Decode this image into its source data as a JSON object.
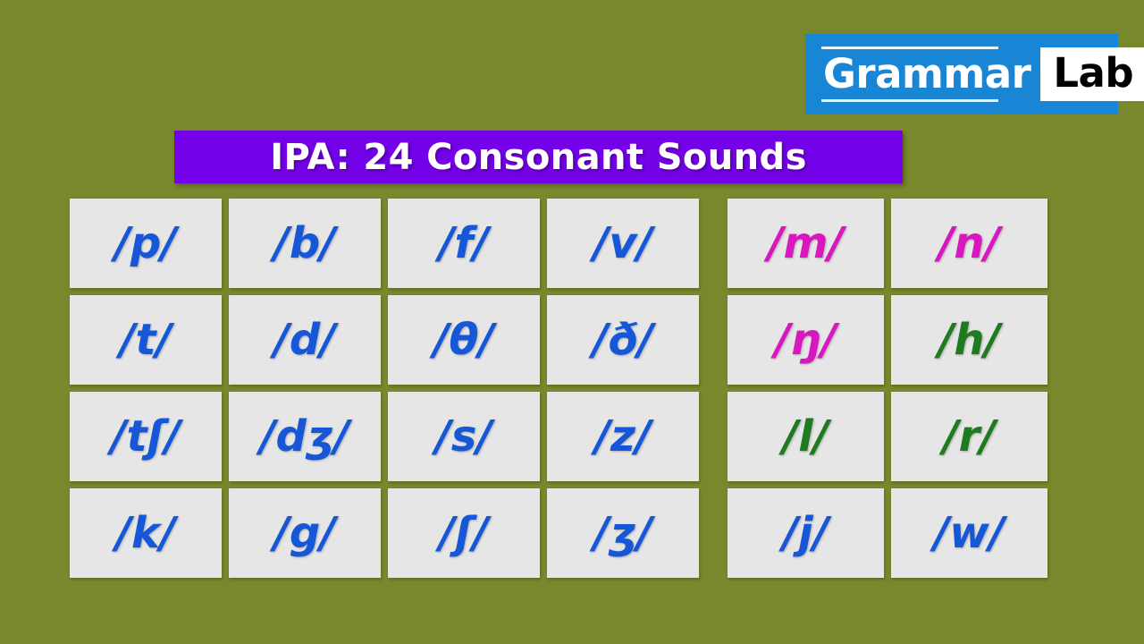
{
  "background_color": "#78882c",
  "logo": {
    "primary_text": "Grammar",
    "secondary_text": "Lab",
    "background_color": "#1886d4",
    "primary_color": "#ffffff",
    "secondary_color": "#000000"
  },
  "title": {
    "text": "IPA: 24 Consonant Sounds",
    "banner_color": "#7302e8",
    "text_color": "#ffffff"
  },
  "colors": {
    "blue": "#1657d8",
    "magenta": "#d916c0",
    "green": "#207a20",
    "cell_background": "#e6e6e6"
  },
  "grid": {
    "left_group": {
      "columns": 4,
      "rows": 4,
      "cells": [
        {
          "symbol": "/p/",
          "color": "blue"
        },
        {
          "symbol": "/t/",
          "color": "blue"
        },
        {
          "symbol": "/tʃ/",
          "color": "blue"
        },
        {
          "symbol": "/k/",
          "color": "blue"
        },
        {
          "symbol": "/b/",
          "color": "blue"
        },
        {
          "symbol": "/d/",
          "color": "blue"
        },
        {
          "symbol": "/dʒ/",
          "color": "blue"
        },
        {
          "symbol": "/g/",
          "color": "blue"
        },
        {
          "symbol": "/f/",
          "color": "blue"
        },
        {
          "symbol": "/θ/",
          "color": "blue"
        },
        {
          "symbol": "/s/",
          "color": "blue"
        },
        {
          "symbol": "/ʃ/",
          "color": "blue"
        },
        {
          "symbol": "/v/",
          "color": "blue"
        },
        {
          "symbol": "/ð/",
          "color": "blue"
        },
        {
          "symbol": "/z/",
          "color": "blue"
        },
        {
          "symbol": "/ʒ/",
          "color": "blue"
        }
      ]
    },
    "right_group": {
      "columns": 2,
      "rows": 4,
      "cells": [
        {
          "symbol": "/m/",
          "color": "magenta"
        },
        {
          "symbol": "/ŋ/",
          "color": "magenta"
        },
        {
          "symbol": "/l/",
          "color": "green"
        },
        {
          "symbol": "/j/",
          "color": "blue"
        },
        {
          "symbol": "/n/",
          "color": "magenta"
        },
        {
          "symbol": "/h/",
          "color": "green"
        },
        {
          "symbol": "/r/",
          "color": "green"
        },
        {
          "symbol": "/w/",
          "color": "blue"
        }
      ]
    }
  }
}
